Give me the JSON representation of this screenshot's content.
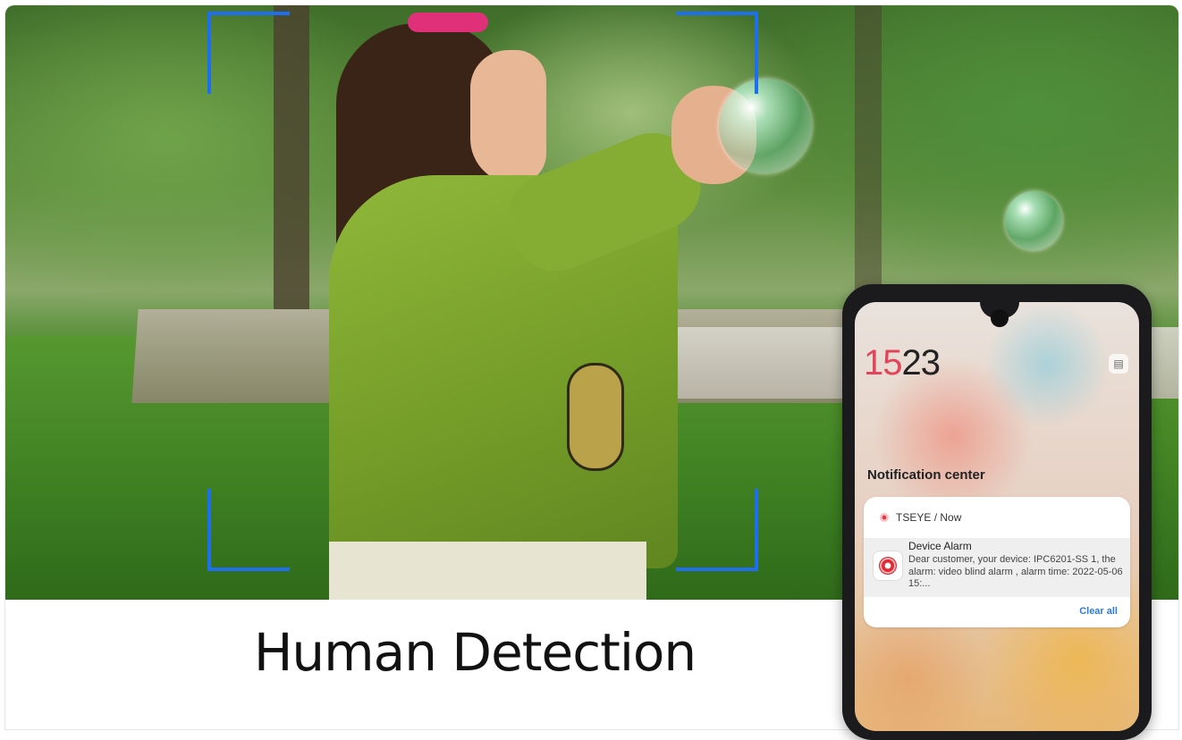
{
  "headline": "Human Detection",
  "detection_frame_color": "#1e6ef0",
  "phone": {
    "clock_hour": "15",
    "clock_minute": "23",
    "message_icon": "message-icon",
    "notification_center_title": "Notification center",
    "notification": {
      "app_name": "TSEYE",
      "separator": " / ",
      "time": "Now",
      "title": "Device Alarm",
      "body": "Dear customer, your device: IPC6201-SS 1, the alarm: video blind alarm , alarm time: 2022-05-06 15:...",
      "clear_all_label": "Clear all"
    }
  }
}
